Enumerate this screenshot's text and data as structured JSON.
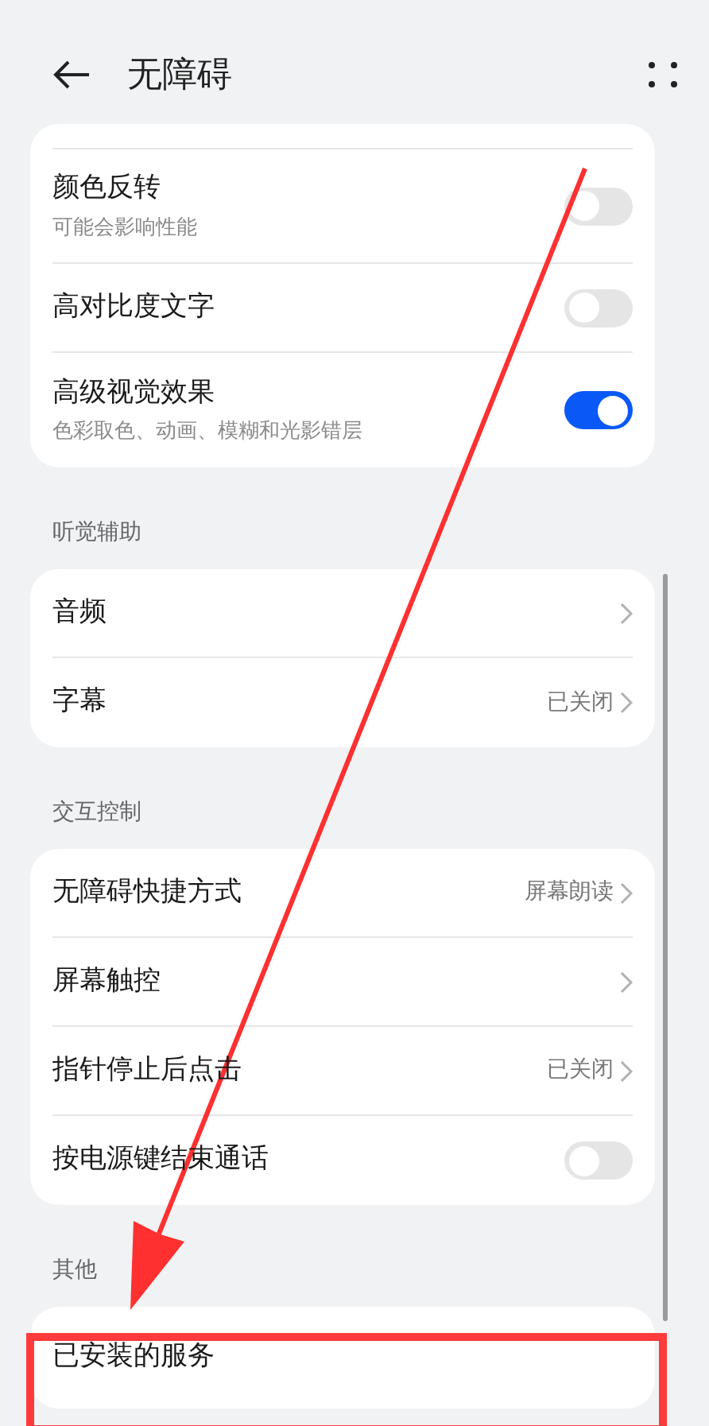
{
  "header": {
    "title": "无障碍"
  },
  "sections": [
    {
      "rows": [
        {
          "kind": "toggle",
          "label": "颜色反转",
          "subtitle": "可能会影响性能",
          "on": false
        },
        {
          "kind": "toggle",
          "label": "高对比度文字",
          "on": false
        },
        {
          "kind": "toggle",
          "label": "高级视觉效果",
          "subtitle": "色彩取色、动画、模糊和光影错层",
          "on": true
        }
      ]
    },
    {
      "title": "听觉辅助",
      "rows": [
        {
          "kind": "link",
          "label": "音频"
        },
        {
          "kind": "link",
          "label": "字幕",
          "value": "已关闭"
        }
      ]
    },
    {
      "title": "交互控制",
      "rows": [
        {
          "kind": "link",
          "label": "无障碍快捷方式",
          "value": "屏幕朗读"
        },
        {
          "kind": "link",
          "label": "屏幕触控"
        },
        {
          "kind": "link",
          "label": "指针停止后点击",
          "value": "已关闭"
        },
        {
          "kind": "toggle",
          "label": "按电源键结束通话",
          "on": false
        }
      ]
    },
    {
      "title": "其他",
      "rows": [
        {
          "kind": "plain",
          "label": "已安装的服务"
        }
      ]
    }
  ]
}
